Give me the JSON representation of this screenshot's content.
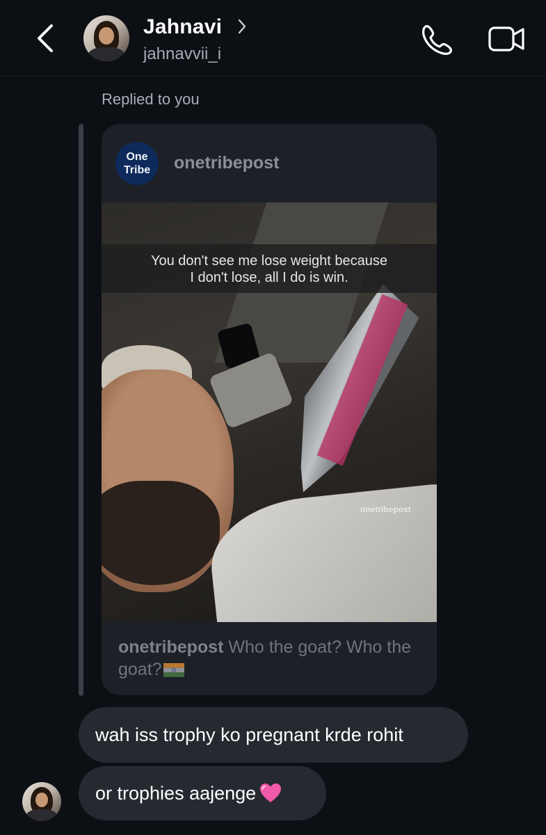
{
  "header": {
    "contact_name": "Jahnavi",
    "username": "jahnavvii_i",
    "icons": {
      "back": "chevron-left-icon",
      "details": "chevron-right-icon",
      "call": "phone-icon",
      "video": "video-camera-icon"
    }
  },
  "reply": {
    "label": "Replied to you"
  },
  "post": {
    "logo_line1": "One",
    "logo_line2": "Tribe",
    "account": "onetribepost",
    "image_caption_line1": "You don't see me lose weight because",
    "image_caption_line2": "I don't lose, all I do is win.",
    "image_watermark": "onetribepost",
    "caption_account": "onetribepost",
    "caption_text": "Who the goat? Who the goat?",
    "caption_emoji": "india-flag"
  },
  "messages": [
    {
      "text": "wah iss trophy ko pregnant krde rohit"
    },
    {
      "text": "or trophies aajenge",
      "emoji": "pink-heart"
    }
  ],
  "colors": {
    "background": "#0c0f14",
    "bubble": "#262930",
    "card": "#1d2026",
    "muted_text": "#a6abb3",
    "logo_bg": "#0e2a5c"
  }
}
